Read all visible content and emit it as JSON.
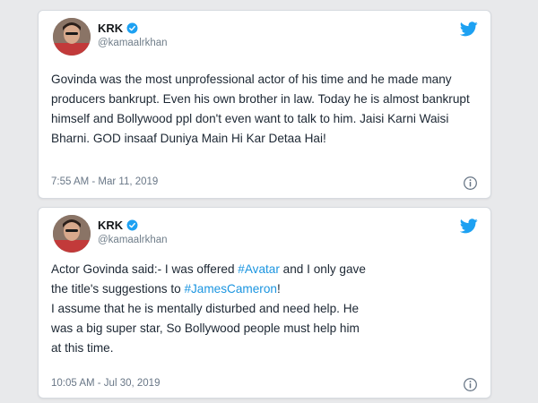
{
  "tweets": [
    {
      "name": "KRK",
      "handle": "@kamaalrkhan",
      "text": "Govinda was the most unprofessional actor of his time and he made many producers bankrupt. Even his own brother in law. Today he is almost bankrupt himself and Bollywood ppl don't even want to talk to him. Jaisi Karni Waisi Bharni. GOD insaaf Duniya Main Hi Kar Detaa Hai!",
      "timestamp": "7:55 AM - Mar 11, 2019"
    },
    {
      "name": "KRK",
      "handle": "@kamaalrkhan",
      "text_parts": [
        "Actor Govinda said:- I was offered ",
        "#Avatar",
        " and I only gave\nthe title's suggestions to ",
        "#JamesCameron",
        "!\nI assume that he is mentally disturbed and need help. He\nwas a big super star, So Bollywood people must help him\nat this time."
      ],
      "timestamp": "10:05 AM - Jul 30, 2019"
    }
  ],
  "colors": {
    "link": "#1b95e0",
    "twitter_blue": "#1da1f2",
    "background": "#e8e9eb"
  },
  "icons": {
    "logo": "twitter-bird-icon",
    "verified": "verified-badge-icon",
    "info": "info-icon"
  }
}
